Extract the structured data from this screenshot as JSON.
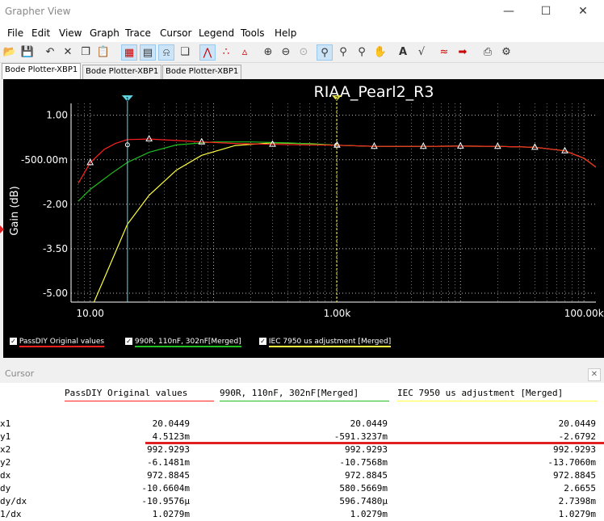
{
  "window": {
    "title": "Grapher View"
  },
  "menu": [
    "File",
    "Edit",
    "View",
    "Graph",
    "Trace",
    "Cursor",
    "Legend",
    "Tools",
    "Help"
  ],
  "tabs": [
    "Bode Plotter-XBP1",
    "Bode Plotter-XBP1",
    "Bode Plotter-XBP1"
  ],
  "chart_data": {
    "type": "line",
    "title": "RIAA_Pearl2_R3",
    "ylabel": "Gain (dB)",
    "xscale": "log",
    "xlim": [
      7,
      125000
    ],
    "ylim": [
      -5.3,
      1.4
    ],
    "yticks": [
      1.0,
      -0.5,
      -2.0,
      -3.5,
      -5.0
    ],
    "ytick_labels": [
      "1.00",
      "-500.00m",
      "-2.00",
      "-3.50",
      "-5.00"
    ],
    "xticks": [
      10,
      1000,
      100000
    ],
    "xtick_labels": [
      "10.00",
      "1.00k",
      "100.00k"
    ],
    "grid": true,
    "colors": {
      "red": "#ff2020",
      "green": "#20c020",
      "yellow": "#ffff40",
      "cursor1": "#5fd3e0",
      "cursor2": "#e0e050"
    },
    "cursors": {
      "x1": 20.0449,
      "x2": 992.9293
    },
    "series": [
      {
        "name": "PassDIY Original values",
        "color": "#ff2020",
        "x": [
          8,
          10,
          13,
          16,
          20,
          30,
          50,
          80,
          150,
          300,
          600,
          1000,
          2000,
          5000,
          10000,
          20000,
          40000,
          70000,
          100000,
          125000
        ],
        "y": [
          -1.3,
          -0.6,
          -0.15,
          0.05,
          0.18,
          0.2,
          0.15,
          0.1,
          0.05,
          0.02,
          0.0,
          -0.01,
          -0.05,
          -0.05,
          -0.04,
          -0.05,
          -0.08,
          -0.2,
          -0.45,
          -0.75
        ]
      },
      {
        "name": "990R, 110nF, 302nF[Merged]",
        "color": "#20c020",
        "x": [
          8,
          10,
          15,
          20,
          30,
          50,
          100,
          200,
          400,
          700,
          1000,
          2000,
          5000,
          10000,
          20000,
          40000,
          70000,
          100000,
          125000
        ],
        "y": [
          -1.9,
          -1.5,
          -0.95,
          -0.59,
          -0.25,
          0.0,
          0.1,
          0.1,
          0.07,
          0.02,
          -0.01,
          -0.05,
          -0.05,
          -0.04,
          -0.05,
          -0.08,
          -0.2,
          -0.45,
          -0.75
        ]
      },
      {
        "name": "IEC 7950 us adjustment [Merged]",
        "color": "#ffff40",
        "x": [
          10,
          13,
          20,
          30,
          50,
          80,
          150,
          300,
          600,
          1000,
          2000,
          5000,
          10000,
          20000,
          40000,
          70000,
          100000,
          125000
        ],
        "y": [
          -5.6,
          -4.5,
          -2.68,
          -1.7,
          -0.85,
          -0.35,
          -0.02,
          0.07,
          0.04,
          -0.01,
          -0.05,
          -0.05,
          -0.04,
          -0.05,
          -0.08,
          -0.2,
          -0.45,
          -0.75
        ]
      }
    ]
  },
  "cursor_panel": {
    "title": "Cursor",
    "columns": [
      "PassDIY Original values",
      "990R, 110nF, 302nF[Merged]",
      "IEC 7950 us adjustment [Merged]"
    ],
    "row_labels": [
      "x1",
      "y1",
      "x2",
      "y2",
      "dx",
      "dy",
      "dy/dx",
      "1/dx"
    ],
    "values": [
      [
        "20.0449",
        "4.5123m",
        "992.9293",
        "-6.1481m",
        "972.8845",
        "-10.6604m",
        "-10.9576µ",
        "1.0279m"
      ],
      [
        "20.0449",
        "-591.3237m",
        "992.9293",
        "-10.7568m",
        "972.8845",
        "580.5669m",
        "596.7480µ",
        "1.0279m"
      ],
      [
        "20.0449",
        "-2.6792",
        "992.9293",
        "-13.7060m",
        "972.8845",
        "2.6655",
        "2.7398m",
        "1.0279m"
      ]
    ]
  }
}
